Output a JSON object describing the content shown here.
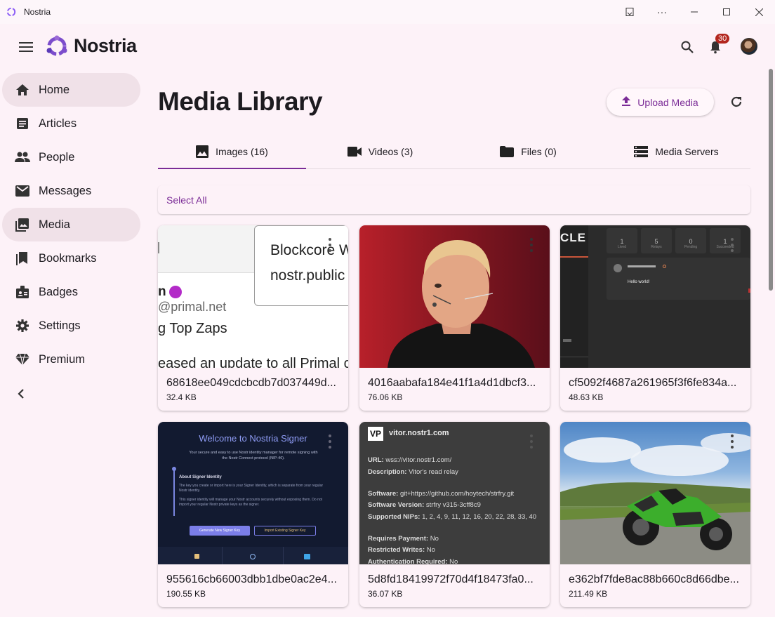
{
  "window": {
    "title": "Nostria"
  },
  "header": {
    "brand": "Nostria",
    "notification_count": "30"
  },
  "sidebar": {
    "items": [
      {
        "label": "Home",
        "icon": "home-icon",
        "active": true
      },
      {
        "label": "Articles",
        "icon": "article-icon",
        "active": false
      },
      {
        "label": "People",
        "icon": "people-icon",
        "active": false
      },
      {
        "label": "Messages",
        "icon": "mail-icon",
        "active": false
      },
      {
        "label": "Media",
        "icon": "photo-library-icon",
        "active": true
      },
      {
        "label": "Bookmarks",
        "icon": "bookmark-icon",
        "active": false
      },
      {
        "label": "Badges",
        "icon": "badge-icon",
        "active": false
      },
      {
        "label": "Settings",
        "icon": "gear-icon",
        "active": false
      },
      {
        "label": "Premium",
        "icon": "diamond-icon",
        "active": false
      }
    ]
  },
  "main": {
    "title": "Media Library",
    "upload_label": "Upload Media",
    "tabs": [
      {
        "label": "Images (16)",
        "icon": "image-icon",
        "active": true
      },
      {
        "label": "Videos (3)",
        "icon": "videocam-icon",
        "active": false
      },
      {
        "label": "Files (0)",
        "icon": "folder-icon",
        "active": false
      },
      {
        "label": "Media Servers",
        "icon": "storage-icon",
        "active": false
      }
    ],
    "select_all": "Select All",
    "media": [
      {
        "name": "68618ee049cdcbcdb7d037449d...",
        "size": "32.4 KB"
      },
      {
        "name": "4016aabafa184e41f1a4d1dbcf3...",
        "size": "76.06 KB"
      },
      {
        "name": "cf5092f4687a261965f3f6fe834a...",
        "size": "48.63 KB"
      },
      {
        "name": "955616cb66003dbb1dbe0ac2e4...",
        "size": "190.55 KB"
      },
      {
        "name": "5d8fd18419972f70d4f18473fa0...",
        "size": "36.07 KB"
      },
      {
        "name": "e362bf7fde8ac88b660c8d66dbe...",
        "size": "211.49 KB"
      }
    ],
    "thumb_text": {
      "t1_a": "Blockcore W",
      "t1_b": "nostr.public",
      "t1_c": "n",
      "t1_d": "@primal.net",
      "t1_e": "g Top Zaps",
      "t1_f": "eased an update to all Primal c",
      "t3_a": "CLE",
      "t3_stats": [
        "1",
        "5",
        "0",
        "1"
      ],
      "t3_stat_labels": [
        "Lived",
        "Relays",
        "Pending",
        "Succeeded"
      ],
      "t3_hello": "Hello world!",
      "t4_title": "Welcome to Nostria Signer",
      "t4_sub": "Your secure and easy to use Nostr identity manager for remote signing with the Nostr Connect protocol (NIP-46).",
      "t4_about": "About Signer Identity",
      "t4_body1": "The key you create or import here is your Signer Identity, which is separate from your regular Nostr identity.",
      "t4_body2": "This signer identity will manage your Nostr accounts securely without exposing them. Do not import your regular Nostr private keys as the signer.",
      "t4_btn1": "Generate New Signer Key",
      "t4_btn2": "Import Existing Signer Key",
      "t5_logo": "VP",
      "t5_host": "vitor.nostr1.com",
      "t5_url_k": "URL:",
      "t5_url_v": "wss://vitor.nostr1.com/",
      "t5_desc_k": "Description:",
      "t5_desc_v": "Vitor's read relay",
      "t5_sw_k": "Software:",
      "t5_sw_v": "git+https://github.com/hoytech/strfry.git",
      "t5_ver_k": "Software Version:",
      "t5_ver_v": "strfry v315-3cff8c9",
      "t5_nips_k": "Supported NIPs:",
      "t5_nips_v": "1, 2, 4, 9, 11, 12, 16, 20, 22, 28, 33, 40",
      "t5_pay_k": "Requires Payment:",
      "t5_pay_v": "No",
      "t5_rw_k": "Restricted Writes:",
      "t5_rw_v": "No",
      "t5_auth_k": "Authentication Required:",
      "t5_auth_v": "No"
    }
  }
}
